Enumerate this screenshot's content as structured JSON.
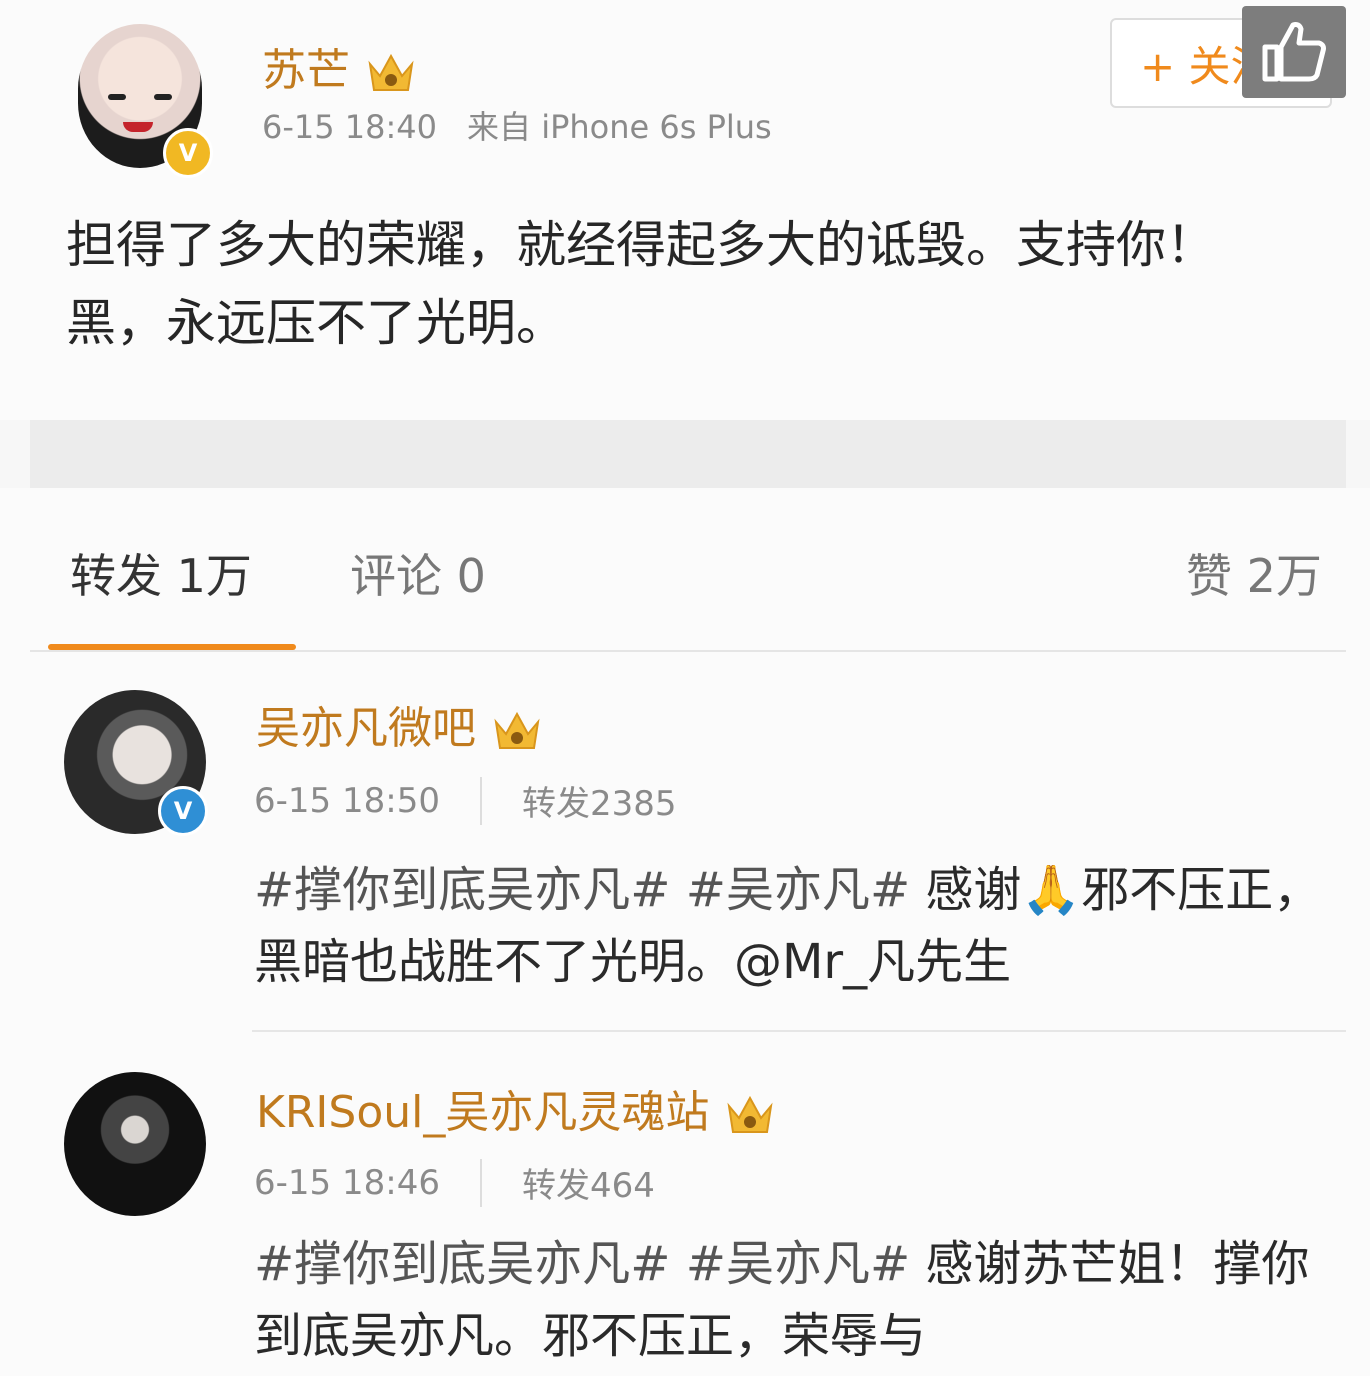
{
  "post": {
    "author": "苏芒",
    "time": "6-15 18:40",
    "source": "来自 iPhone 6s Plus",
    "follow_label": "+ 关注",
    "body": "担得了多大的荣耀，就经得起多大的诋毁。支持你！黑，永远压不了光明。"
  },
  "tabs": {
    "repost": "转发 1万",
    "comment": "评论 0",
    "like": "赞 2万"
  },
  "reposts": [
    {
      "name": "吴亦凡微吧",
      "time": "6-15 18:50",
      "reposts": "转发2385",
      "text_hash1": "#撑你到底吴亦凡#",
      "text_hash2": "#吴亦凡#",
      "text_rest": " 感谢🙏邪不压正，黑暗也战胜不了光明。@Mr_凡先生"
    },
    {
      "name": "KRISoul_吴亦凡灵魂站",
      "time": "6-15 18:46",
      "reposts": "转发464",
      "text_hash1": "#撑你到底吴亦凡#",
      "text_hash2": "#吴亦凡#",
      "text_rest": " 感谢苏芒姐！撑你到底吴亦凡。邪不压正，荣辱与"
    }
  ],
  "colors": {
    "accent_orange": "#f08a1c",
    "name_gold": "#c07a1e",
    "verified_gold": "#f1b823",
    "verified_blue": "#2f8fd5"
  }
}
